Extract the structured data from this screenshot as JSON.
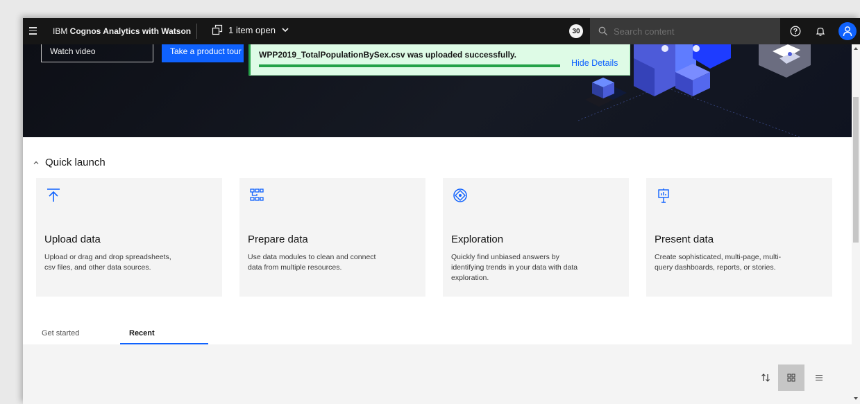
{
  "header": {
    "app_title_prefix": "IBM ",
    "app_title_bold": "Cognos Analytics with Watson",
    "items_open": "1 item open",
    "badge_count": "30",
    "search_placeholder": "Search content"
  },
  "hero": {
    "watch_video": "Watch video",
    "product_tour": "Take a product tour"
  },
  "toast": {
    "message": "WPP2019_TotalPopulationBySex.csv was uploaded successfully.",
    "link": "Hide Details",
    "progress": 1.0
  },
  "quick_launch": {
    "title": "Quick launch",
    "cards": [
      {
        "title": "Upload data",
        "desc": "Upload or drag and drop spreadsheets, csv files, and other data sources.",
        "icon": "upload-icon"
      },
      {
        "title": "Prepare data",
        "desc": "Use data modules to clean and connect data from multiple resources.",
        "icon": "data-module-icon"
      },
      {
        "title": "Exploration",
        "desc": "Quickly find unbiased answers by identifying trends in your data with data exploration.",
        "icon": "compass-icon"
      },
      {
        "title": "Present data",
        "desc": "Create sophisticated, multi-page, multi-query dashboards, reports, or stories.",
        "icon": "presentation-icon"
      }
    ]
  },
  "tabs": {
    "get_started": "Get started",
    "recent": "Recent"
  },
  "colors": {
    "accent": "#0f62fe",
    "topbar": "#161616",
    "success": "#24a148",
    "success_bg": "#defbe6"
  }
}
